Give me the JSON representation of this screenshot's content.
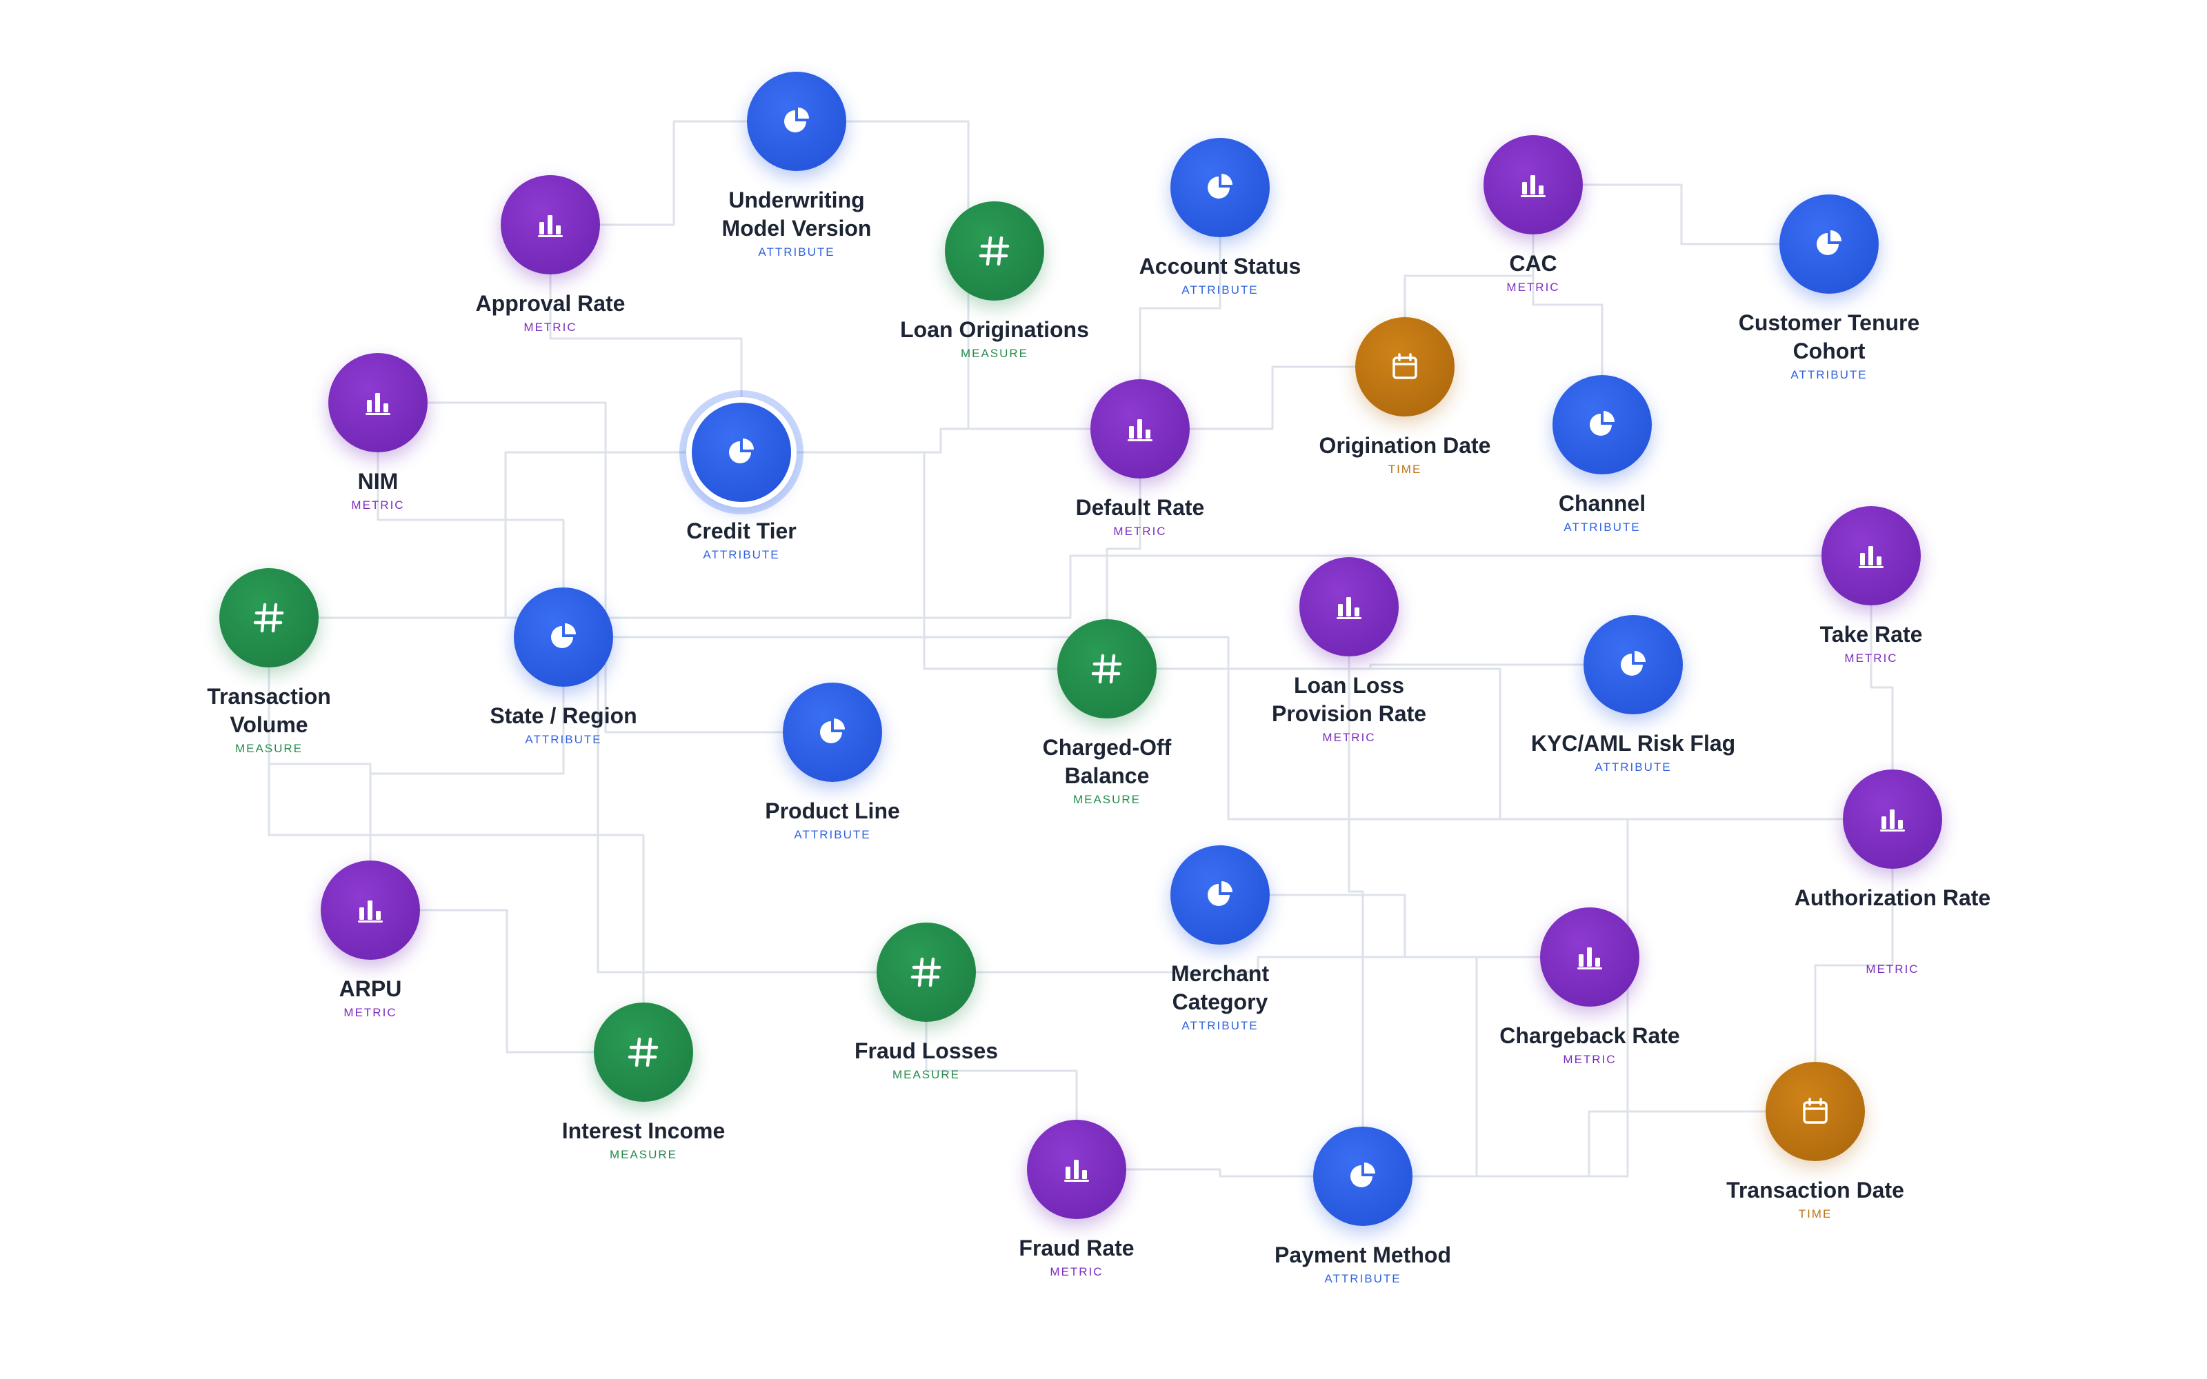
{
  "type_labels": {
    "metric": "Metric",
    "attribute": "Attribute",
    "measure": "Measure",
    "time": "Time"
  },
  "node_colors": {
    "metric": "#7b2bbf",
    "attribute": "#2f62df",
    "measure": "#248b4b",
    "time": "#b97412"
  },
  "icon_names": {
    "metric": "bar-chart-icon",
    "attribute": "pie-chart-icon",
    "measure": "hash-icon",
    "time": "calendar-icon"
  },
  "selected_node": "Credit Tier",
  "nodes": [
    {
      "id": "underwriting-model-version",
      "label": "Underwriting Model Version",
      "type": "attribute"
    },
    {
      "id": "approval-rate",
      "label": "Approval Rate",
      "type": "metric"
    },
    {
      "id": "loan-originations",
      "label": "Loan Originations",
      "type": "measure"
    },
    {
      "id": "account-status",
      "label": "Account Status",
      "type": "attribute"
    },
    {
      "id": "cac",
      "label": "CAC",
      "type": "metric"
    },
    {
      "id": "customer-tenure-cohort",
      "label": "Customer Tenure Cohort",
      "type": "attribute"
    },
    {
      "id": "nim",
      "label": "NIM",
      "type": "metric"
    },
    {
      "id": "credit-tier",
      "label": "Credit Tier",
      "type": "attribute"
    },
    {
      "id": "default-rate",
      "label": "Default Rate",
      "type": "metric"
    },
    {
      "id": "origination-date",
      "label": "Origination Date",
      "type": "time"
    },
    {
      "id": "channel",
      "label": "Channel",
      "type": "attribute"
    },
    {
      "id": "transaction-volume",
      "label": "Transaction Volume",
      "type": "measure"
    },
    {
      "id": "state-region",
      "label": "State / Region",
      "type": "attribute"
    },
    {
      "id": "product-line",
      "label": "Product Line",
      "type": "attribute"
    },
    {
      "id": "charged-off-balance",
      "label": "Charged-Off Balance",
      "type": "measure"
    },
    {
      "id": "loan-loss-provision-rate",
      "label": "Loan Loss Provision Rate",
      "type": "metric"
    },
    {
      "id": "kyc-aml-risk-flag",
      "label": "KYC/AML Risk Flag",
      "type": "attribute"
    },
    {
      "id": "take-rate",
      "label": "Take Rate",
      "type": "metric"
    },
    {
      "id": "authorization-rate",
      "label": "Authorization Rate",
      "type": "metric"
    },
    {
      "id": "arpu",
      "label": "ARPU",
      "type": "metric"
    },
    {
      "id": "merchant-category",
      "label": "Merchant Category",
      "type": "attribute"
    },
    {
      "id": "fraud-losses",
      "label": "Fraud Losses",
      "type": "measure"
    },
    {
      "id": "chargeback-rate",
      "label": "Chargeback Rate",
      "type": "metric"
    },
    {
      "id": "interest-income",
      "label": "Interest Income",
      "type": "measure"
    },
    {
      "id": "fraud-rate",
      "label": "Fraud Rate",
      "type": "metric"
    },
    {
      "id": "payment-method",
      "label": "Payment Method",
      "type": "attribute"
    },
    {
      "id": "transaction-date",
      "label": "Transaction Date",
      "type": "time"
    }
  ],
  "edges": [
    [
      "approval-rate",
      "underwriting-model-version"
    ],
    [
      "approval-rate",
      "credit-tier"
    ],
    [
      "underwriting-model-version",
      "default-rate"
    ],
    [
      "account-status",
      "default-rate"
    ],
    [
      "default-rate",
      "origination-date"
    ],
    [
      "origination-date",
      "cac"
    ],
    [
      "cac",
      "channel"
    ],
    [
      "cac",
      "customer-tenure-cohort"
    ],
    [
      "credit-tier",
      "default-rate"
    ],
    [
      "credit-tier",
      "charged-off-balance"
    ],
    [
      "default-rate",
      "charged-off-balance"
    ],
    [
      "nim",
      "product-line"
    ],
    [
      "nim",
      "state-region"
    ],
    [
      "transaction-volume",
      "take-rate"
    ],
    [
      "transaction-volume",
      "credit-tier"
    ],
    [
      "transaction-volume",
      "arpu"
    ],
    [
      "transaction-volume",
      "fraud-losses"
    ],
    [
      "transaction-volume",
      "interest-income"
    ],
    [
      "charged-off-balance",
      "kyc-aml-risk-flag"
    ],
    [
      "charged-off-balance",
      "authorization-rate"
    ],
    [
      "arpu",
      "state-region"
    ],
    [
      "arpu",
      "interest-income"
    ],
    [
      "state-region",
      "authorization-rate"
    ],
    [
      "merchant-category",
      "chargeback-rate"
    ],
    [
      "fraud-losses",
      "chargeback-rate"
    ],
    [
      "fraud-losses",
      "fraud-rate"
    ],
    [
      "loan-loss-provision-rate",
      "payment-method"
    ],
    [
      "take-rate",
      "authorization-rate"
    ],
    [
      "authorization-rate",
      "transaction-date"
    ],
    [
      "authorization-rate",
      "payment-method"
    ],
    [
      "fraud-rate",
      "payment-method"
    ],
    [
      "transaction-date",
      "payment-method"
    ],
    [
      "chargeback-rate",
      "payment-method"
    ]
  ]
}
